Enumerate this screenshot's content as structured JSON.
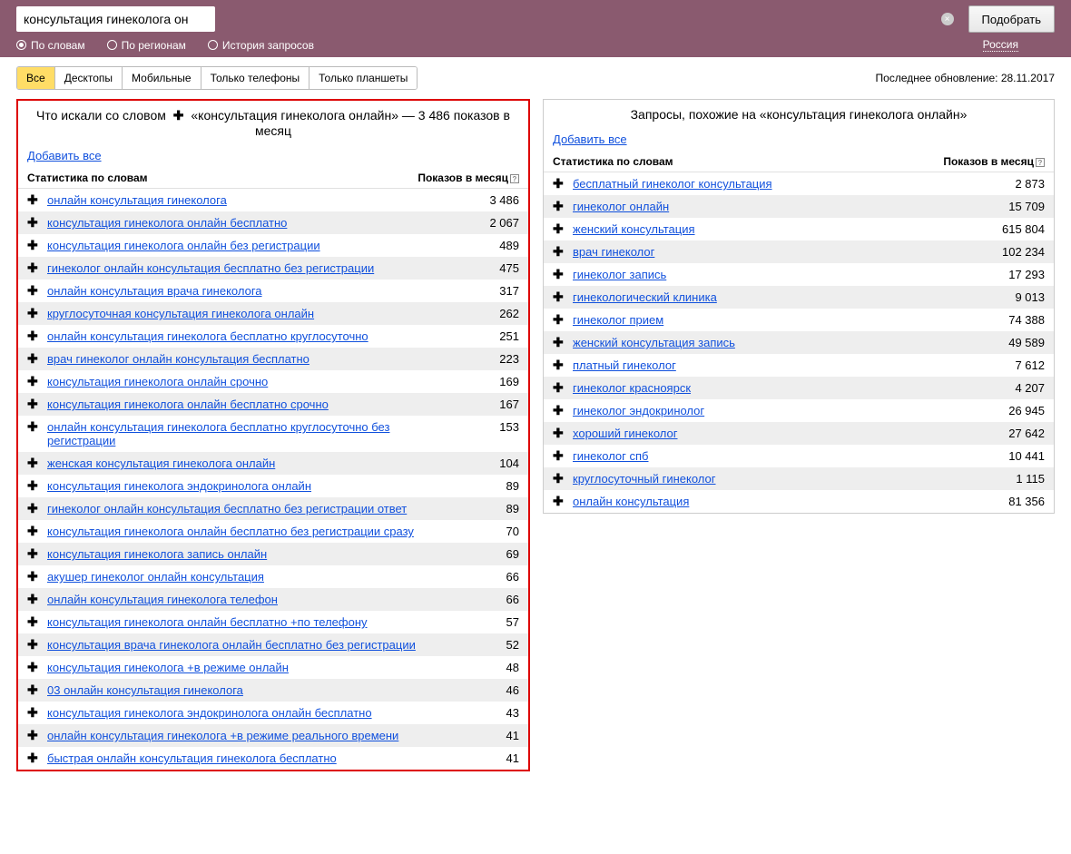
{
  "search": {
    "value": "консультация гинеколога онлайн",
    "submit": "Подобрать"
  },
  "radios": {
    "by_words": "По словам",
    "by_regions": "По регионам",
    "history": "История запросов"
  },
  "region_link": "Россия",
  "tabs": {
    "all": "Все",
    "desktop": "Десктопы",
    "mobile": "Мобильные",
    "phones": "Только телефоны",
    "tablets": "Только планшеты"
  },
  "last_update": "Последнее обновление: 28.11.2017",
  "left": {
    "title_prefix": "Что искали со словом",
    "title_query": "«консультация гинеколога онлайн» — 3 486 показов в месяц",
    "add_all": "Добавить все",
    "col_stat": "Статистика по словам",
    "col_count": "Показов в месяц",
    "rows": [
      {
        "kw": "онлайн консультация гинеколога",
        "cnt": "3 486"
      },
      {
        "kw": "консультация гинеколога онлайн бесплатно",
        "cnt": "2 067"
      },
      {
        "kw": "консультация гинеколога онлайн без регистрации",
        "cnt": "489"
      },
      {
        "kw": "гинеколог онлайн консультация бесплатно без регистрации",
        "cnt": "475"
      },
      {
        "kw": "онлайн консультация врача гинеколога",
        "cnt": "317"
      },
      {
        "kw": "круглосуточная консультация гинеколога онлайн",
        "cnt": "262"
      },
      {
        "kw": "онлайн консультация гинеколога бесплатно круглосуточно",
        "cnt": "251"
      },
      {
        "kw": "врач гинеколог онлайн консультация бесплатно",
        "cnt": "223"
      },
      {
        "kw": "консультация гинеколога онлайн срочно",
        "cnt": "169"
      },
      {
        "kw": "консультация гинеколога онлайн бесплатно срочно",
        "cnt": "167"
      },
      {
        "kw": "онлайн консультация гинеколога бесплатно круглосуточно без регистрации",
        "cnt": "153"
      },
      {
        "kw": "женская консультация гинеколога онлайн",
        "cnt": "104"
      },
      {
        "kw": "консультация гинеколога эндокринолога онлайн",
        "cnt": "89"
      },
      {
        "kw": "гинеколог онлайн консультация бесплатно без регистрации ответ",
        "cnt": "89"
      },
      {
        "kw": "консультация гинеколога онлайн бесплатно без регистрации сразу",
        "cnt": "70"
      },
      {
        "kw": "консультация гинеколога запись онлайн",
        "cnt": "69"
      },
      {
        "kw": "акушер гинеколог онлайн консультация",
        "cnt": "66"
      },
      {
        "kw": "онлайн консультация гинеколога телефон",
        "cnt": "66"
      },
      {
        "kw": "консультация гинеколога онлайн бесплатно +по телефону",
        "cnt": "57"
      },
      {
        "kw": "консультация врача гинеколога онлайн бесплатно без регистрации",
        "cnt": "52"
      },
      {
        "kw": "консультация гинеколога +в режиме онлайн",
        "cnt": "48"
      },
      {
        "kw": "03 онлайн консультация гинеколога",
        "cnt": "46"
      },
      {
        "kw": "консультация гинеколога эндокринолога онлайн бесплатно",
        "cnt": "43"
      },
      {
        "kw": "онлайн консультация гинеколога +в режиме реального времени",
        "cnt": "41"
      },
      {
        "kw": "быстрая онлайн консультация гинеколога бесплатно",
        "cnt": "41"
      }
    ]
  },
  "right": {
    "title": "Запросы, похожие на «консультация гинеколога онлайн»",
    "add_all": "Добавить все",
    "col_stat": "Статистика по словам",
    "col_count": "Показов в месяц",
    "rows": [
      {
        "kw": "бесплатный гинеколог консультация",
        "cnt": "2 873"
      },
      {
        "kw": "гинеколог онлайн",
        "cnt": "15 709"
      },
      {
        "kw": "женский консультация",
        "cnt": "615 804"
      },
      {
        "kw": "врач гинеколог",
        "cnt": "102 234"
      },
      {
        "kw": "гинеколог запись",
        "cnt": "17 293"
      },
      {
        "kw": "гинекологический клиника",
        "cnt": "9 013"
      },
      {
        "kw": "гинеколог прием",
        "cnt": "74 388"
      },
      {
        "kw": "женский консультация запись",
        "cnt": "49 589"
      },
      {
        "kw": "платный гинеколог",
        "cnt": "7 612"
      },
      {
        "kw": "гинеколог красноярск",
        "cnt": "4 207"
      },
      {
        "kw": "гинеколог эндокринолог",
        "cnt": "26 945"
      },
      {
        "kw": "хороший гинеколог",
        "cnt": "27 642"
      },
      {
        "kw": "гинеколог спб",
        "cnt": "10 441"
      },
      {
        "kw": "круглосуточный гинеколог",
        "cnt": "1 115"
      },
      {
        "kw": "онлайн консультация",
        "cnt": "81 356"
      }
    ]
  }
}
